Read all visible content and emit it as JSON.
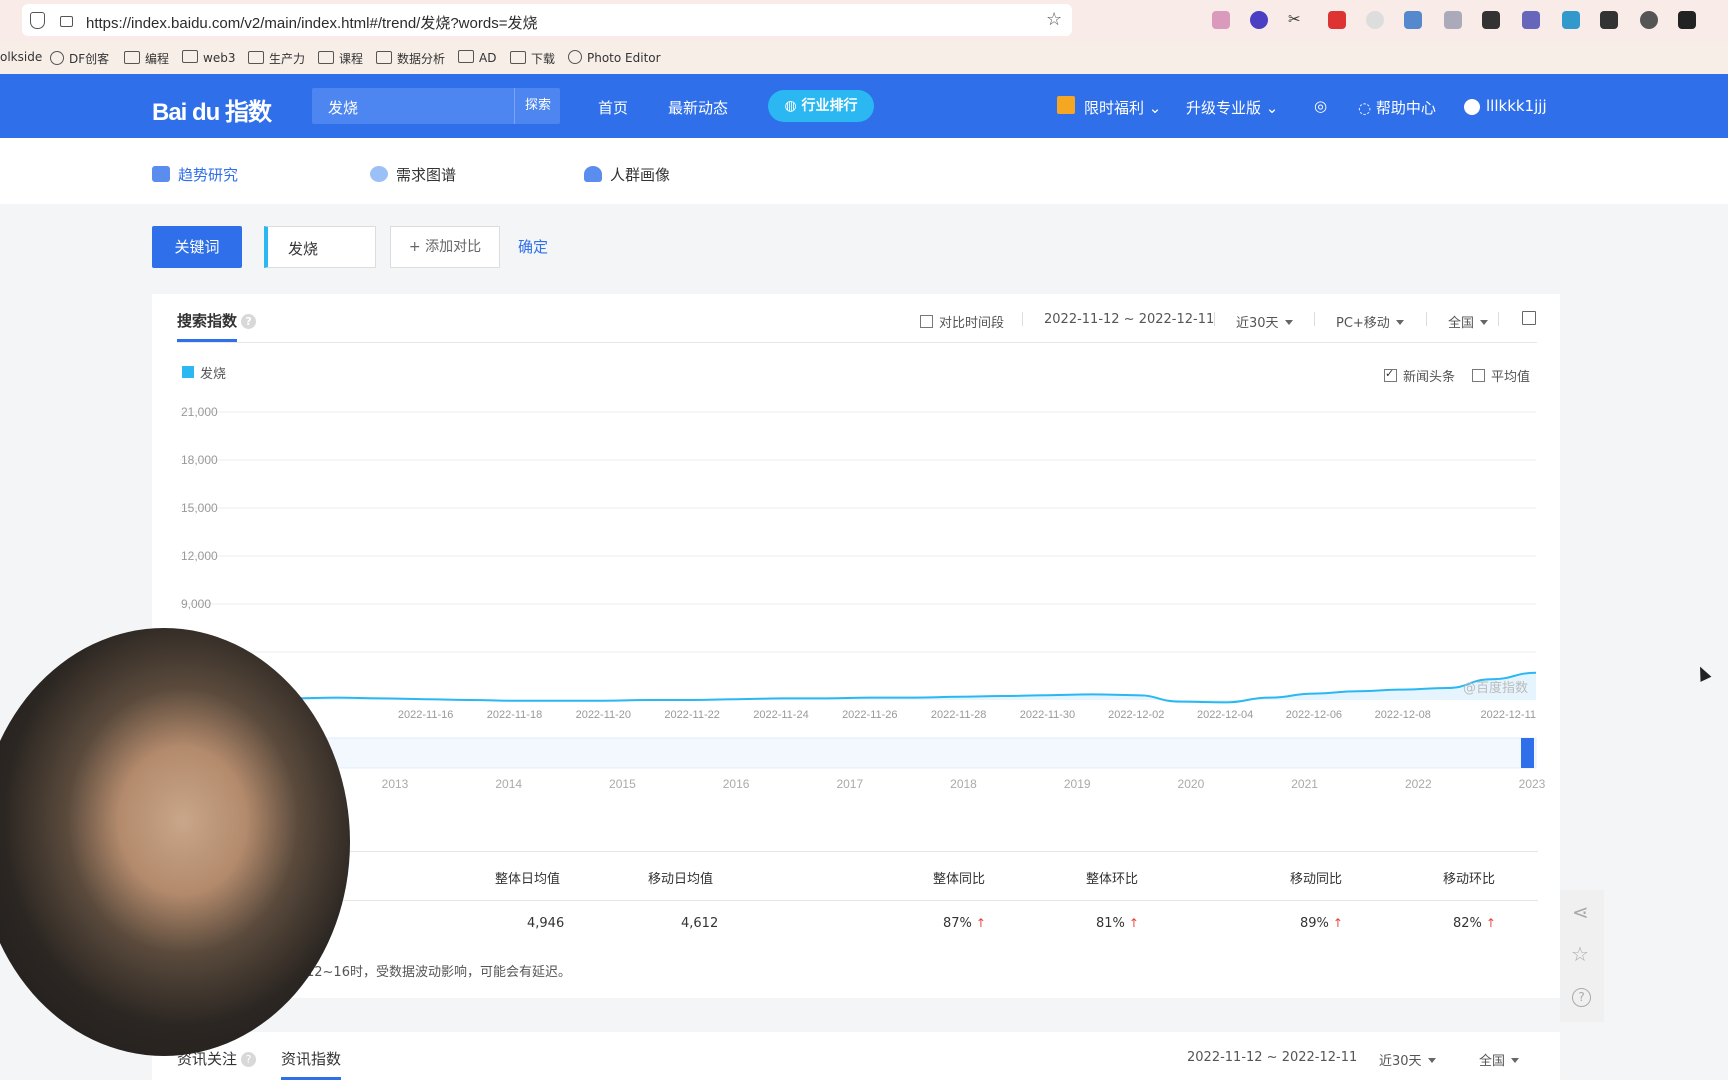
{
  "browser": {
    "url": "https://index.baidu.com/v2/main/index.html#/trend/发烧?words=发烧",
    "bookmarks": [
      "olkside",
      "DF创客",
      "编程",
      "web3",
      "生产力",
      "课程",
      "数据分析",
      "AD",
      "下载",
      "Photo Editor"
    ]
  },
  "header": {
    "logo": "Bai du 指数",
    "search_value": "发烧",
    "search_button": "探索",
    "nav": [
      "首页",
      "最新动态"
    ],
    "rank_label": "行业排行",
    "welfare": "限时福利",
    "upgrade": "升级专业版",
    "help": "帮助中心",
    "user": "lllkkk1jjj"
  },
  "subnav": [
    "趋势研究",
    "需求图谱",
    "人群画像"
  ],
  "keyword_row": {
    "tag": "关键词",
    "keyword": "发烧",
    "add_compare": "+ 添加对比",
    "confirm": "确定"
  },
  "search_index": {
    "tab": "搜索指数",
    "compare_period": "对比时间段",
    "date_range": "2022-11-12 ~ 2022-12-11",
    "period": "近30天",
    "device": "PC+移动",
    "region": "全国",
    "legend": "发烧",
    "news_headline": "新闻头条",
    "average": "平均值",
    "watermark": "@百度指数"
  },
  "chart_data": {
    "type": "area",
    "series": [
      {
        "name": "发烧"
      }
    ],
    "y_ticks": [
      "21,000",
      "18,000",
      "15,000",
      "12,000",
      "9,000",
      "6,000"
    ],
    "ylim": [
      3000,
      21000
    ],
    "x_ticks": [
      "2022-11-16",
      "2022-11-18",
      "2022-11-20",
      "2022-11-22",
      "2022-11-24",
      "2022-11-26",
      "2022-11-28",
      "2022-11-30",
      "2022-12-02",
      "2022-12-04",
      "2022-12-06",
      "2022-12-08",
      "2022-12-11"
    ],
    "x": [
      "2022-11-12",
      "2022-11-13",
      "2022-11-14",
      "2022-11-15",
      "2022-11-16",
      "2022-11-17",
      "2022-11-18",
      "2022-11-19",
      "2022-11-20",
      "2022-11-21",
      "2022-11-22",
      "2022-11-23",
      "2022-11-24",
      "2022-11-25",
      "2022-11-26",
      "2022-11-27",
      "2022-11-28",
      "2022-11-29",
      "2022-11-30",
      "2022-12-01",
      "2022-12-02",
      "2022-12-03",
      "2022-12-04",
      "2022-12-05",
      "2022-12-06",
      "2022-12-07",
      "2022-12-08",
      "2022-12-09",
      "2022-12-10",
      "2022-12-11"
    ],
    "values": [
      3050,
      3100,
      3150,
      3100,
      3050,
      3000,
      2950,
      2950,
      2950,
      3000,
      3000,
      3050,
      3100,
      3100,
      3150,
      3150,
      3200,
      3250,
      3300,
      3350,
      3300,
      2900,
      2850,
      3150,
      3400,
      3550,
      3650,
      3750,
      4300,
      4700
    ],
    "timeline_ticks": [
      "2013",
      "2014",
      "2015",
      "2016",
      "2017",
      "2018",
      "2019",
      "2020",
      "2021",
      "2022",
      "2023"
    ],
    "grid": true
  },
  "stats": {
    "headers": [
      "整体日均值",
      "移动日均值",
      "整体同比",
      "整体环比",
      "移动同比",
      "移动环比"
    ],
    "values": [
      "4,946",
      "4,612",
      "87%",
      "81%",
      "89%",
      "82%"
    ],
    "note": "12~16时，受数据波动影响，可能会有延迟。"
  },
  "news_card": {
    "tab1": "资讯关注",
    "tab2": "资讯指数",
    "date_range": "2022-11-12 ~ 2022-12-11",
    "period": "近30天",
    "region": "全国"
  },
  "colors": {
    "brand": "#2f6fea",
    "series": "#2ab7f2",
    "up": "#e8453c"
  }
}
